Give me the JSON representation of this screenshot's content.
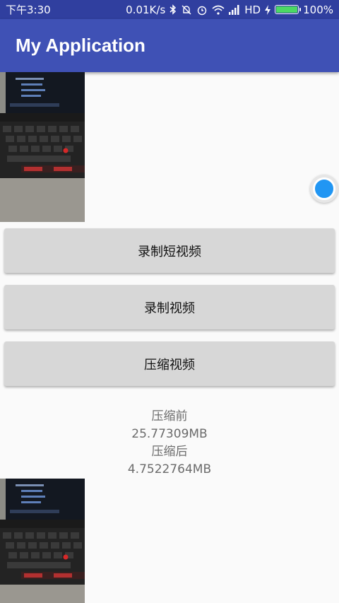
{
  "status_bar": {
    "time": "下午3:30",
    "network_speed": "0.01K/s",
    "network_type": "HD",
    "battery_percent": "100%",
    "battery_level": 1.0,
    "icons": [
      "bluetooth-icon",
      "mute-icon",
      "alarm-icon",
      "wifi-icon",
      "signal-icon",
      "charging-icon",
      "battery-icon"
    ]
  },
  "app_bar": {
    "title": "My Application"
  },
  "buttons": {
    "record_short": "录制短视频",
    "record": "录制视频",
    "compress": "压缩视频"
  },
  "compression": {
    "before_label": "压缩前",
    "before_size": "25.77309MB",
    "after_label": "压缩后",
    "after_size": "4.7522764MB"
  },
  "colors": {
    "status_bar": "#303f9f",
    "app_bar": "#3f51b5",
    "accent": "#2196f3",
    "button": "#d7d7d7"
  }
}
